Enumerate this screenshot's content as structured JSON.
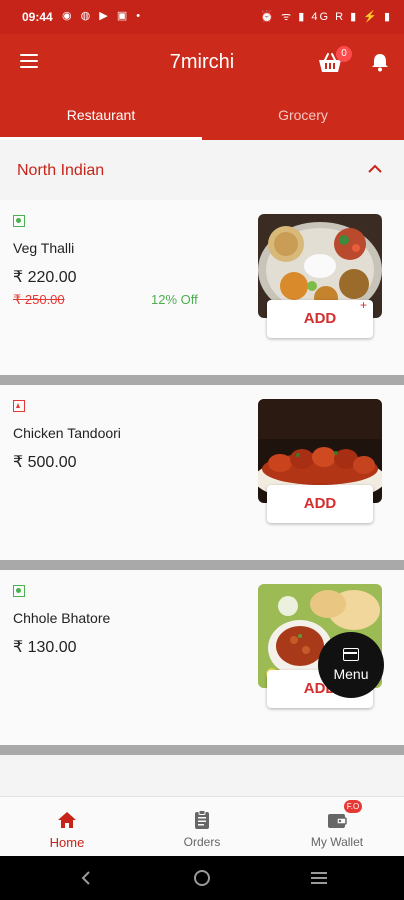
{
  "status_bar": {
    "time": "09:44",
    "left_icons": "◉ ◍ ▶ ▣ •",
    "right_icons": "⏰ ᯤ ▮ 4G R ▮ ⚡ ▮"
  },
  "header": {
    "title": "7mirchi",
    "cart_count": "0"
  },
  "tabs": [
    {
      "label": "Restaurant",
      "active": true
    },
    {
      "label": "Grocery",
      "active": false
    }
  ],
  "category": {
    "title": "North Indian",
    "expanded": true
  },
  "items": [
    {
      "name": "Veg Thalli",
      "type": "veg",
      "price": "₹ 220.00",
      "mrp": "₹ 250.00",
      "discount": "12% Off",
      "add_label": "ADD",
      "plus": "+"
    },
    {
      "name": "Chicken Tandoori",
      "type": "non-veg",
      "price": "₹ 500.00",
      "add_label": "ADD"
    },
    {
      "name": "Chhole Bhatore",
      "type": "veg",
      "price": "₹ 130.00",
      "add_label": "ADD"
    }
  ],
  "menu_fab": {
    "label": "Menu"
  },
  "bottom_nav": [
    {
      "label": "Home",
      "active": true,
      "icon": "home-icon"
    },
    {
      "label": "Orders",
      "active": false,
      "icon": "clipboard-icon"
    },
    {
      "label": "My Wallet",
      "active": false,
      "icon": "wallet-icon",
      "badge": "F.O"
    }
  ],
  "colors": {
    "primary": "#cc2a1b",
    "veg": "#4caf50",
    "non_veg": "#e53935"
  }
}
